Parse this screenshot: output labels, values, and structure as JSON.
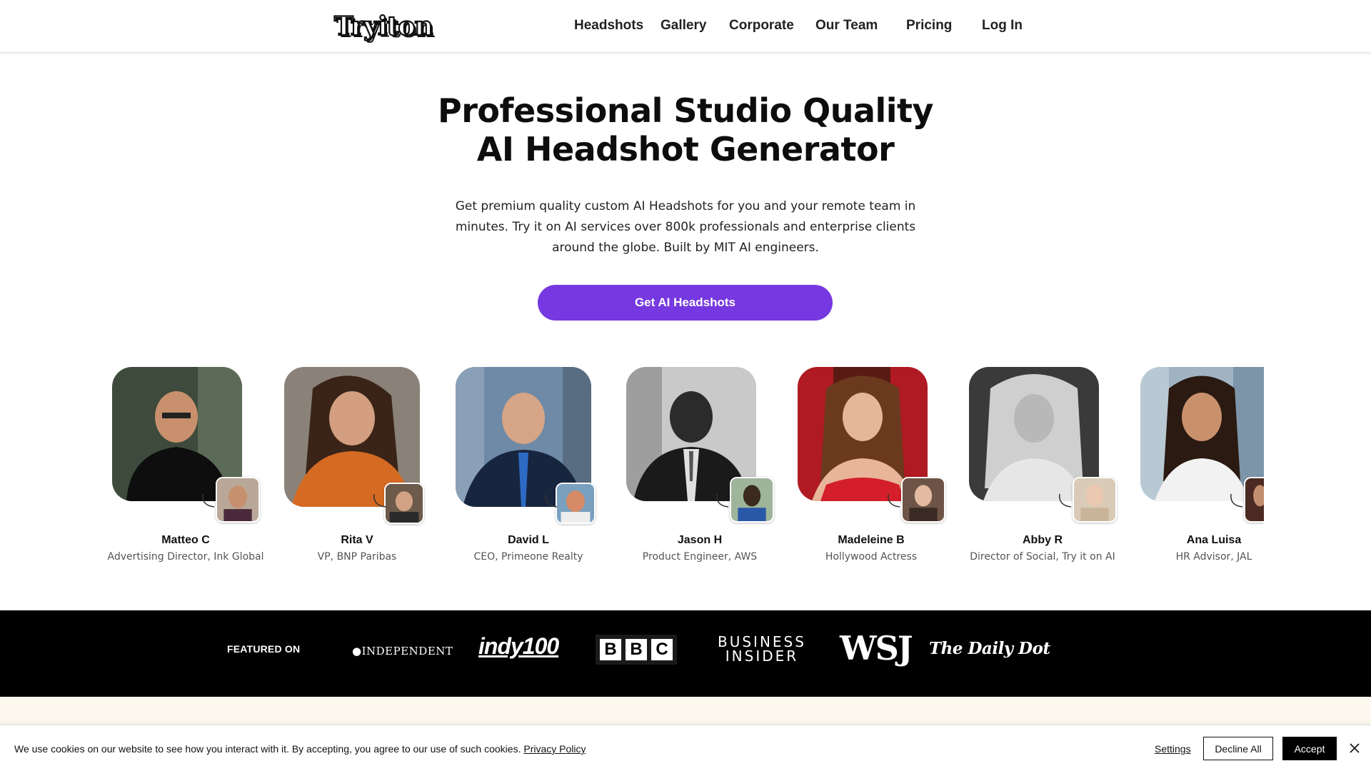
{
  "header": {
    "logo_text": "Tryiton",
    "nav": [
      {
        "label": "Headshots"
      },
      {
        "label": "Gallery"
      },
      {
        "label": "Corporate"
      },
      {
        "label": "Our Team"
      },
      {
        "label": "Pricing"
      },
      {
        "label": "Log In"
      }
    ]
  },
  "hero": {
    "title_line1": "Professional Studio Quality",
    "title_line2": "AI Headshot Generator",
    "subtitle": "Get premium quality custom AI Headshots for you and your remote team in minutes. Try it on AI services over 800k professionals and enterprise clients around the globe. Built by MIT AI engineers.",
    "cta": "Get AI Headshots"
  },
  "people": [
    {
      "name": "Matteo C",
      "role": "Advertising Director, Ink Global"
    },
    {
      "name": "Rita V",
      "role": "VP, BNP Paribas"
    },
    {
      "name": "David L",
      "role": "CEO, Primeone Realty"
    },
    {
      "name": "Jason H",
      "role": "Product Engineer, AWS"
    },
    {
      "name": "Madeleine B",
      "role": "Hollywood Actress"
    },
    {
      "name": "Abby R",
      "role": "Director of Social, Try it on AI"
    },
    {
      "name": "Ana Luisa",
      "role": "HR Advisor, JAL"
    }
  ],
  "featured": {
    "label": "FEATURED ON",
    "logos": {
      "independent": "INDEPENDENT",
      "indy100": "indy100",
      "bbc": [
        "B",
        "B",
        "C"
      ],
      "business_insider_1": "BUSINESS",
      "business_insider_2": "INSIDER",
      "wsj": "WSJ",
      "daily_dot": "The Daily Dot"
    }
  },
  "cookie": {
    "text": "We use cookies on our website to see how you interact with it. By accepting, you agree to our use of such cookies.",
    "privacy_link": "Privacy Policy",
    "settings": "Settings",
    "decline": "Decline All",
    "accept": "Accept"
  },
  "colors": {
    "accent": "#7638e0",
    "band": "#000000",
    "cream": "#fdf8ee"
  }
}
